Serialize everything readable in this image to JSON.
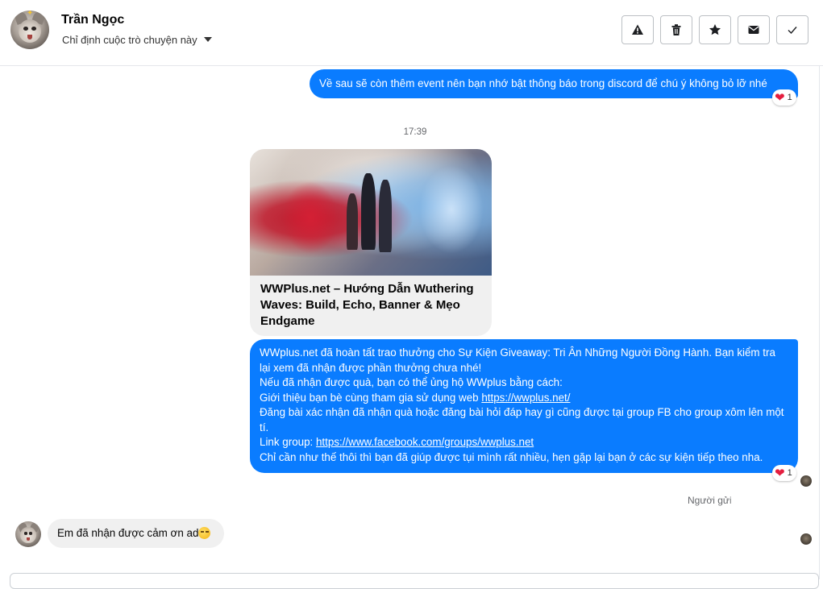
{
  "header": {
    "contact_name": "Trần Ngọc",
    "subtitle": "Chỉ định cuộc trò chuyện này",
    "tools": [
      {
        "icon": "warning-icon",
        "label": "Report"
      },
      {
        "icon": "trash-icon",
        "label": "Delete"
      },
      {
        "icon": "star-icon",
        "label": "Star"
      },
      {
        "icon": "envelope-icon",
        "label": "Mark unread"
      },
      {
        "icon": "checkmark-icon",
        "label": "Done"
      }
    ]
  },
  "messages": {
    "msg1": {
      "text": "Về sau sẽ còn thêm event nên bạn nhớ bật thông báo trong discord để chú ý không bỏ lỡ nhé",
      "reaction_count": "1"
    },
    "timestamp": "17:39",
    "link_card": {
      "title": "WWPlus.net – Hướng Dẫn Wuthering Waves: Build, Echo, Banner & Mẹo Endgame"
    },
    "msg2": {
      "line1": "WWplus.net đã hoàn tất trao thưởng cho Sự Kiện Giveaway: Tri Ân Những Người Đồng Hành. Bạn kiểm tra lại xem đã nhận được phần thưởng chưa nhé!",
      "line2": "Nếu đã nhận được quà, bạn có thể ủng hộ WWplus bằng cách:",
      "line3_prefix": "Giới thiệu bạn bè cùng tham gia sử dụng web ",
      "line3_link": "https://wwplus.net/",
      "line4": "Đăng bài xác nhận đã nhận quà hoặc đăng bài hỏi đáp hay gì cũng được tại group FB cho group xôm lên một tí.",
      "line5_prefix": "Link group: ",
      "line5_link": "https://www.facebook.com/groups/wwplus.net",
      "line6": "Chỉ cần như thế thôi thì bạn đã giúp được tụi mình rất nhiều, hẹn gặp lại bạn ở các sự kiện tiếp theo nha.",
      "reaction_count": "1"
    },
    "sender_note": "Người gửi",
    "reply": {
      "text": "Em đã nhận được cảm ơn ad"
    }
  },
  "colors": {
    "outgoing_bubble": "#0a7cff",
    "incoming_bubble": "#f0f0f0",
    "reaction_heart": "#e41e3f"
  }
}
